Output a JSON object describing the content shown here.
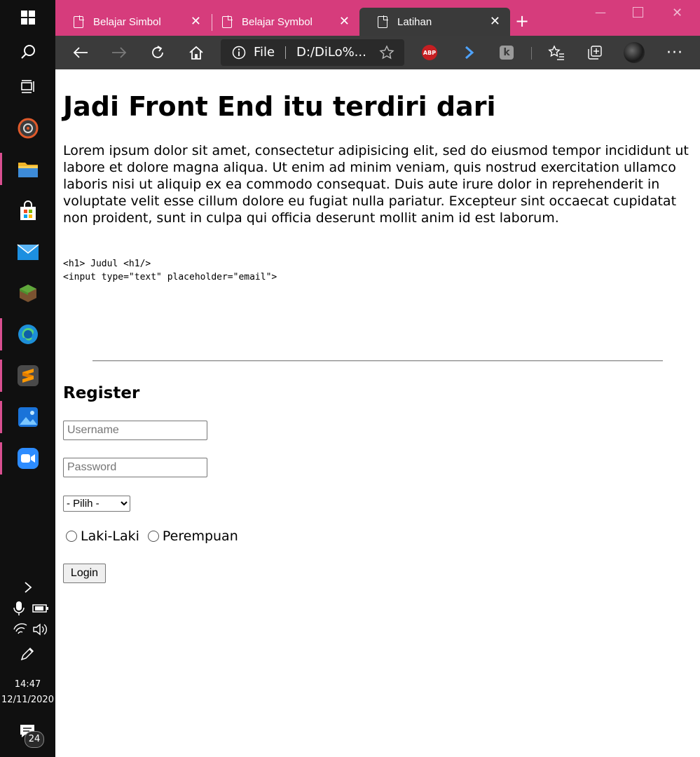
{
  "browser": {
    "tabs": [
      {
        "label": "Belajar Simbol"
      },
      {
        "label": "Belajar Symbol"
      },
      {
        "label": "Latihan"
      }
    ],
    "address": {
      "scheme_label": "File",
      "url": "D:/DiLo%..."
    },
    "extensions": {
      "abp_label": "ABP"
    }
  },
  "page": {
    "title": "Jadi Front End itu terdiri dari",
    "paragraph": "Lorem ipsum dolor sit amet, consectetur adipisicing elit, sed do eiusmod tempor incididunt ut labore et dolore magna aliqua. Ut enim ad minim veniam, quis nostrud exercitation ullamco laboris nisi ut aliquip ex ea commodo consequat. Duis aute irure dolor in reprehenderit in voluptate velit esse cillum dolore eu fugiat nulla pariatur. Excepteur sint occaecat cupidatat non proident, sunt in culpa qui officia deserunt mollit anim id est laborum.",
    "code": "<h1> Judul <h1/>\n<input type=\"text\" placeholder=\"email\">",
    "register": {
      "heading": "Register",
      "username_placeholder": "Username",
      "password_placeholder": "Password",
      "select_value": "- Pilih -",
      "radio_male": "Laki-Laki",
      "radio_female": "Perempuan",
      "login_label": "Login"
    }
  },
  "taskbar": {
    "time": "14:47",
    "date": "12/11/2020",
    "notification_count": "24"
  },
  "colors": {
    "tabstrip": "#d63c7c",
    "toolbar": "#3b3b3b",
    "taskbar": "#101010"
  }
}
